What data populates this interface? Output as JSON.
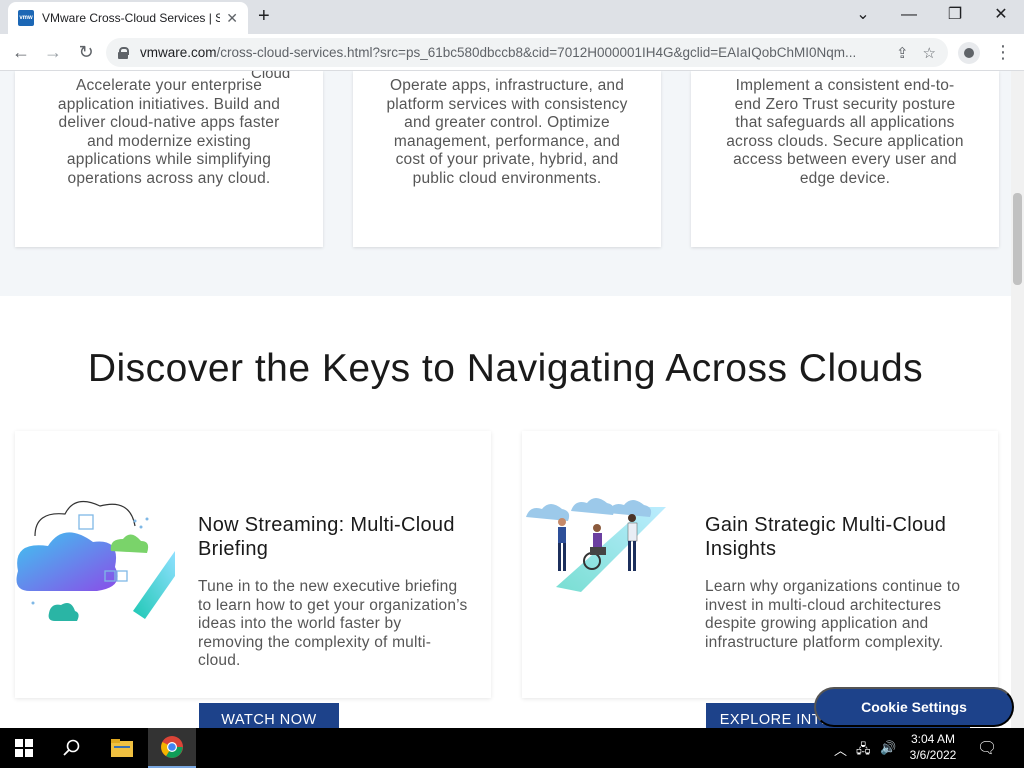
{
  "browser": {
    "tab_title": "VMware Cross-Cloud Services | S",
    "favicon_text": "vmw",
    "url_host": "vmware.com",
    "url_rest": "/cross-cloud-services.html?src=ps_61bc580dbccb8&cid=7012H000001IH4G&gclid=EAIaIQobChMI0Nqm...",
    "icons": [
      "back-icon",
      "forward-icon",
      "reload-icon",
      "lock-icon",
      "share-icon",
      "star-icon",
      "profile-icon",
      "menu-icon",
      "minimize-icon",
      "maximize-icon",
      "close-icon",
      "chevron-down-icon",
      "new-tab-icon"
    ]
  },
  "top_cards": {
    "cloud_fragment": "Cloud",
    "card1": "Accelerate your enterprise application initiatives. Build and deliver cloud-native apps faster and modernize existing applications while simplifying operations across any cloud.",
    "card2": "Operate apps, infrastructure, and platform services with consistency and greater control. Optimize management, performance, and cost of your private, hybrid, and public cloud environments.",
    "card3": "Implement a consistent end-to-end Zero Trust security posture that safeguards all applications across clouds. Secure application access between every user and edge device."
  },
  "section": {
    "title": "Discover the Keys to Navigating Across Clouds"
  },
  "features": [
    {
      "title": "Now Streaming: Multi-Cloud Briefing",
      "description": "Tune in to the new executive briefing to learn how to get your organization’s ideas into the world faster by removing the complexity of multi-cloud.",
      "cta": "WATCH NOW"
    },
    {
      "title": "Gain Strategic Multi-Cloud Insights",
      "description": "Learn why organizations continue to invest in multi-cloud architectures despite growing application and infrastructure platform complexity.",
      "cta": "EXPLORE INTERACTIVE EBOOK"
    }
  ],
  "cookie": {
    "label": "Cookie Settings"
  },
  "taskbar": {
    "time": "3:04 AM",
    "date": "3/6/2022"
  },
  "colors": {
    "accent": "#1d428a",
    "band": "#f3f6f9",
    "tabbar": "#dee1e6"
  }
}
